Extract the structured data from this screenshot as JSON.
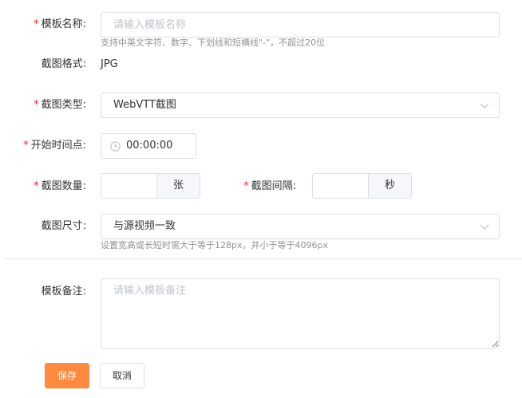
{
  "form": {
    "template_name": {
      "label": "模板名称:",
      "required": "*",
      "placeholder": "请输入模板名称",
      "hint": "支持中英文字符、数字、下划线和短横线\"-\"，不超过20位"
    },
    "format": {
      "label": "截图格式:",
      "value": "JPG"
    },
    "shot_type": {
      "label": "截图类型:",
      "required": "*",
      "value": "WebVTT截图"
    },
    "start_time": {
      "label": "开始时间点:",
      "required": "*",
      "value": "00:00:00"
    },
    "shot_count": {
      "label": "截图数量:",
      "required": "*",
      "value": "",
      "unit": "张"
    },
    "shot_interval": {
      "label": "截图间隔:",
      "required": "*",
      "value": "",
      "unit": "秒"
    },
    "shot_size": {
      "label": "截图尺寸:",
      "value": "与源视频一致",
      "hint": "设置宽高或长短时需大于等于128px，并小于等于4096px"
    },
    "remark": {
      "label": "模板备注:",
      "placeholder": "请输入模板备注"
    }
  },
  "actions": {
    "save_label": "保存",
    "cancel_label": "取消"
  },
  "icons": {
    "select_arrow": "chevron-down-icon",
    "time": "clock-icon"
  },
  "colors": {
    "primary": "#ff8a3d",
    "required": "#f5222d",
    "border": "#dcdfe6",
    "hint": "#909399"
  }
}
